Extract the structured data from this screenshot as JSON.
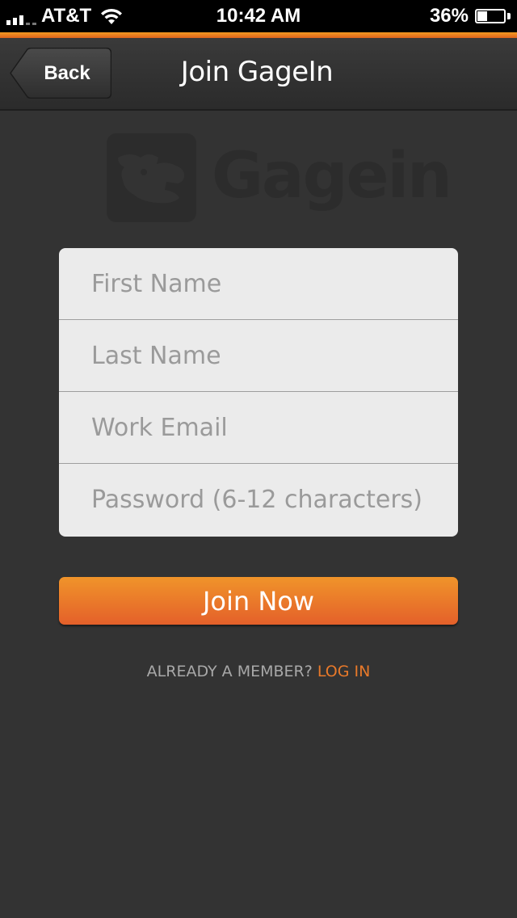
{
  "status_bar": {
    "carrier": "AT&T",
    "time": "10:42 AM",
    "battery_percent": "36%",
    "battery_level": 0.36,
    "signal_bars": 3,
    "icons": [
      "signal-icon",
      "wifi-icon",
      "battery-icon"
    ]
  },
  "nav": {
    "back_label": "Back",
    "title": "Join GageIn"
  },
  "logo": {
    "word": "Gagein"
  },
  "form": {
    "first_name_placeholder": "First Name",
    "last_name_placeholder": "Last Name",
    "email_placeholder": "Work Email",
    "password_placeholder": "Password (6-12 characters)",
    "first_name_value": "",
    "last_name_value": "",
    "email_value": "",
    "password_value": ""
  },
  "join_button_label": "Join Now",
  "footer": {
    "member_prompt": "ALREADY A MEMBER?",
    "login_label": "LOG IN"
  },
  "colors": {
    "accent": "#e8792a",
    "background": "#333333",
    "card": "#ebebeb"
  }
}
